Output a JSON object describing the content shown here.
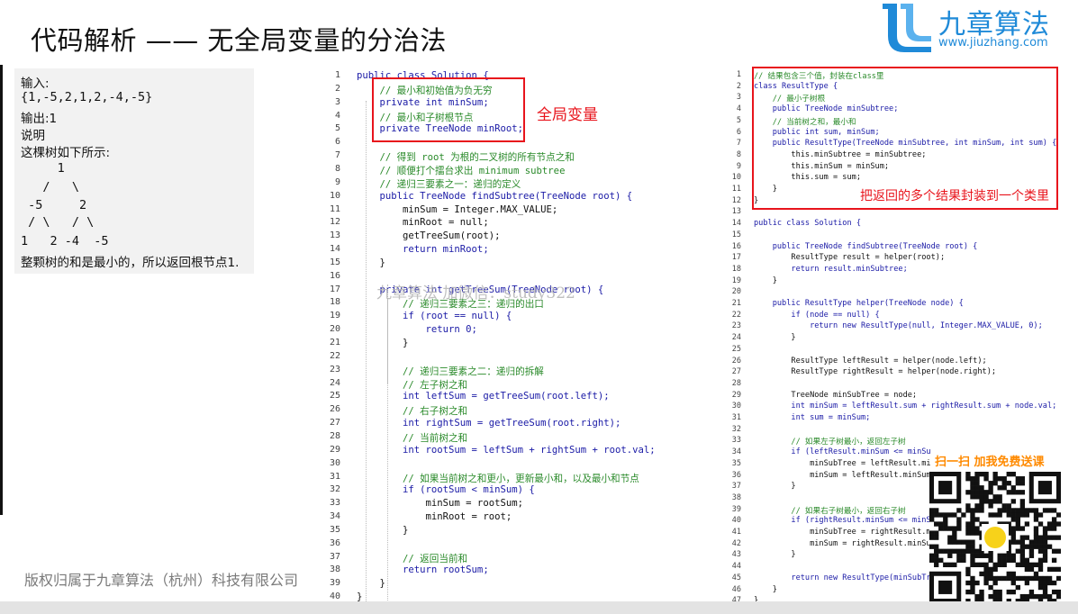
{
  "header": {
    "title": "代码解析 —— 无全局变量的分治法"
  },
  "logo": {
    "name": "九章算法",
    "url": "www.jiuzhang.com",
    "brand_color": "#1f8ad8"
  },
  "example": {
    "lines": [
      "输入:",
      "{1,-5,2,1,2,-4,-5}",
      "输出:1",
      "说明",
      "这棵树如下所示:",
      "     1",
      "   /   \\",
      " -5     2",
      " / \\   / \\",
      "1   2 -4  -5",
      "整颗树的和是最小的，所以返回根节点1."
    ]
  },
  "code_left": {
    "line_numbers": [
      "1",
      "2",
      "3",
      "4",
      "5",
      "6",
      "7",
      "8",
      "9",
      "10",
      "11",
      "12",
      "13",
      "14",
      "15",
      "16",
      "17",
      "18",
      "19",
      "20",
      "21",
      "22",
      "23",
      "24",
      "25",
      "26",
      "27",
      "28",
      "29",
      "30",
      "31",
      "32",
      "33",
      "34",
      "35",
      "36",
      "37",
      "38",
      "39",
      "40"
    ],
    "lines": [
      "public class Solution {",
      "    // 最小和初始值为负无穷",
      "    private int minSum;",
      "    // 最小和子树根节点",
      "    private TreeNode minRoot;",
      "",
      "    // 得到 root 为根的二叉树的所有节点之和",
      "    // 顺便打个擂台求出 minimum subtree",
      "    // 递归三要素之一：递归的定义",
      "    public TreeNode findSubtree(TreeNode root) {",
      "        minSum = Integer.MAX_VALUE;",
      "        minRoot = null;",
      "        getTreeSum(root);",
      "        return minRoot;",
      "    }",
      "",
      "    private int getTreeSum(TreeNode root) {",
      "        // 递归三要素之三：递归的出口",
      "        if (root == null) {",
      "            return 0;",
      "        }",
      "",
      "        // 递归三要素之二：递归的拆解",
      "        // 左子树之和",
      "        int leftSum = getTreeSum(root.left);",
      "        // 右子树之和",
      "        int rightSum = getTreeSum(root.right);",
      "        // 当前树之和",
      "        int rootSum = leftSum + rightSum + root.val;",
      "",
      "        // 如果当前树之和更小，更新最小和，以及最小和节点",
      "        if (rootSum < minSum) {",
      "            minSum = rootSum;",
      "            minRoot = root;",
      "        }",
      "",
      "        // 返回当前和",
      "        return rootSum;",
      "    }",
      "}"
    ]
  },
  "code_right": {
    "line_numbers": [
      "1",
      "2",
      "3",
      "4",
      "5",
      "6",
      "7",
      "8",
      "9",
      "10",
      "11",
      "12",
      "13",
      "14",
      "15",
      "16",
      "17",
      "18",
      "19",
      "20",
      "21",
      "22",
      "23",
      "24",
      "25",
      "26",
      "27",
      "28",
      "29",
      "30",
      "31",
      "32",
      "33",
      "34",
      "35",
      "36",
      "37",
      "38",
      "39",
      "40",
      "41",
      "42",
      "43",
      "44",
      "45",
      "46",
      "47"
    ],
    "lines": [
      "// 结果包含三个值，封装在class里",
      "class ResultType {",
      "    // 最小子树根",
      "    public TreeNode minSubtree;",
      "    // 当前树之和，最小和",
      "    public int sum, minSum;",
      "    public ResultType(TreeNode minSubtree, int minSum, int sum) {",
      "        this.minSubtree = minSubtree;",
      "        this.minSum = minSum;",
      "        this.sum = sum;",
      "    }",
      "}",
      "",
      "public class Solution {",
      "",
      "    public TreeNode findSubtree(TreeNode root) {",
      "        ResultType result = helper(root);",
      "        return result.minSubtree;",
      "    }",
      "",
      "    public ResultType helper(TreeNode node) {",
      "        if (node == null) {",
      "            return new ResultType(null, Integer.MAX_VALUE, 0);",
      "        }",
      "",
      "        ResultType leftResult = helper(node.left);",
      "        ResultType rightResult = helper(node.right);",
      "",
      "        TreeNode minSubTree = node;",
      "        int minSum = leftResult.sum + rightResult.sum + node.val;",
      "        int sum = minSum;",
      "",
      "        // 如果左子树最小，返回左子树",
      "        if (leftResult.minSum <= minSu",
      "            minSubTree = leftResult.mi",
      "            minSum = leftResult.minSum",
      "        }",
      "",
      "        // 如果右子树最小，返回右子树",
      "        if (rightResult.minSum <= minS",
      "            minSubTree = rightResult.m",
      "            minSum = rightResult.minSu",
      "        }",
      "",
      "        return new ResultType(minSubTr",
      "    }",
      "}"
    ]
  },
  "annotations": {
    "global_var_label": "全局变量",
    "encapsulate_label": "把返回的多个结果封装到一个类里",
    "accent_color": "#e8141c"
  },
  "watermark": "九章算法  加微信：study322",
  "copyright": "版权归属于九章算法（杭州）科技有限公司",
  "promo": {
    "text": "扫一扫 加我免费送课",
    "color": "#ff8a00"
  }
}
